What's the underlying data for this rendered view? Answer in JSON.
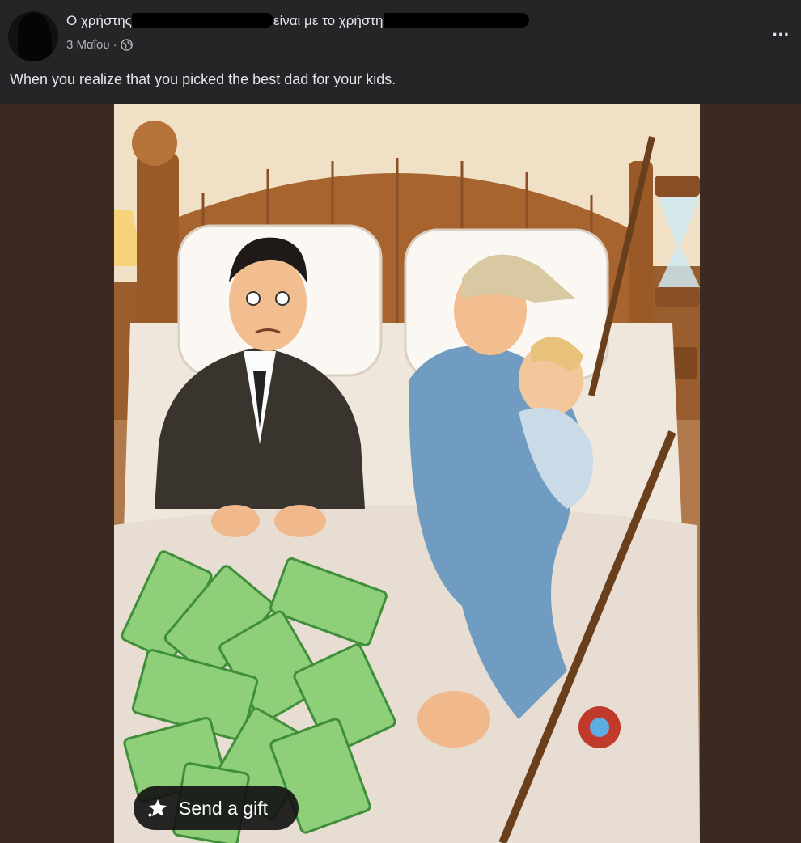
{
  "post": {
    "author_prefix": "Ο χρήστης",
    "author_middle": "είναι με το χρήστη",
    "date": "3 Μαΐου",
    "separator": "·",
    "privacy_icon": "globe-icon",
    "more_label": "...",
    "caption": "When you realize that you picked the best dad for your kids."
  },
  "image": {
    "alt_icon": "illustration"
  },
  "overlay": {
    "gift_label": "Send a gift",
    "gift_icon": "gift-sparkle-icon"
  },
  "colors": {
    "header_bg": "#242526",
    "page_bg": "#3b2a22",
    "text_primary": "#e4e6eb",
    "text_secondary": "#b0b3b8"
  }
}
